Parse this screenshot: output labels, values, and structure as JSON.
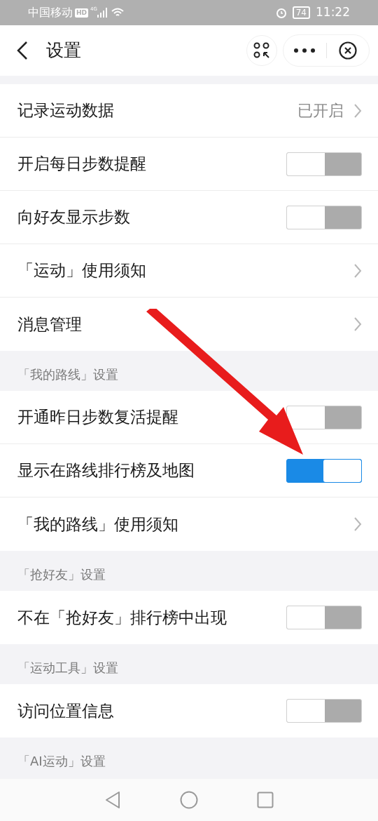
{
  "status_bar": {
    "carrier": "中国移动",
    "badge": "HD",
    "network": "4G",
    "battery": "74",
    "time": "11:22"
  },
  "header": {
    "title": "设置"
  },
  "sections": [
    {
      "items": [
        {
          "kind": "value",
          "label": "记录运动数据",
          "value": "已开启"
        },
        {
          "kind": "switch",
          "label": "开启每日步数提醒",
          "on": false
        },
        {
          "kind": "switch",
          "label": "向好友显示步数",
          "on": false
        },
        {
          "kind": "link",
          "label": "「运动」使用须知"
        },
        {
          "kind": "link",
          "label": "消息管理"
        }
      ]
    },
    {
      "title": "「我的路线」设置",
      "items": [
        {
          "kind": "switch",
          "label": "开通昨日步数复活提醒",
          "on": false
        },
        {
          "kind": "switch",
          "label": "显示在路线排行榜及地图",
          "on": true
        },
        {
          "kind": "link",
          "label": "「我的路线」使用须知"
        }
      ]
    },
    {
      "title": "「抢好友」设置",
      "items": [
        {
          "kind": "switch",
          "label": "不在「抢好友」排行榜中出现",
          "on": false
        }
      ]
    },
    {
      "title": "「运动工具」设置",
      "items": [
        {
          "kind": "switch",
          "label": "访问位置信息",
          "on": false
        }
      ]
    },
    {
      "title": "「AI运动」设置"
    }
  ]
}
